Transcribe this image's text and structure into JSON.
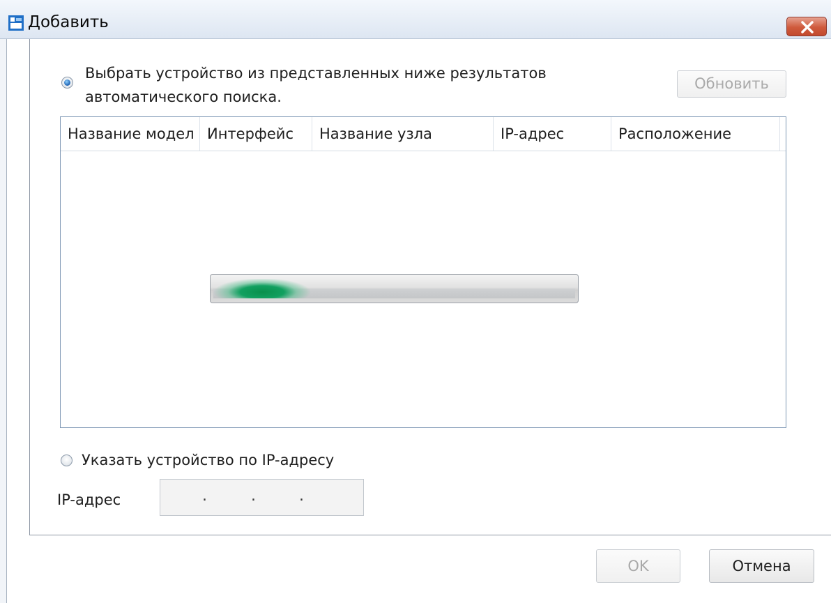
{
  "window": {
    "title": "Добавить",
    "close_glyph": "×"
  },
  "auto_search": {
    "label_line1": "Выбрать устройство из представленных ниже результатов",
    "label_line2": "автоматического поиска.",
    "selected": true,
    "refresh_label": "Обновить"
  },
  "table": {
    "columns": [
      "Название модел",
      "Интерфейс",
      "Название узла",
      "IP-адрес",
      "Расположение"
    ],
    "rows": []
  },
  "progress": {
    "state": "indeterminate",
    "color": "#0b9150"
  },
  "manual": {
    "label": "Указать устройство по IP-адресу",
    "selected": false,
    "ip_label": "IP-адрес",
    "ip_separators": [
      ".",
      ".",
      "."
    ]
  },
  "buttons": {
    "ok": "OK",
    "cancel": "Отмена"
  },
  "icons": {
    "app": "app-window-icon",
    "close": "close-icon"
  }
}
